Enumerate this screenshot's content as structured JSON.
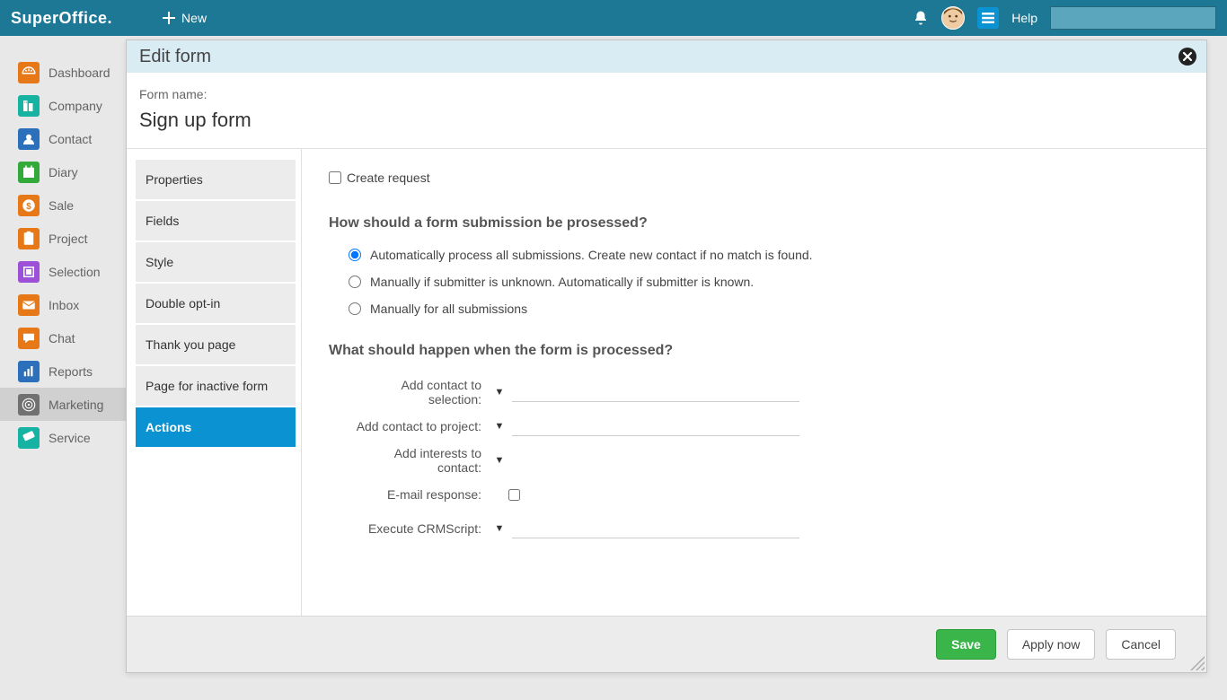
{
  "topbar": {
    "logo": "SuperOffice",
    "new_label": "New",
    "help_label": "Help"
  },
  "sidebar": {
    "items": [
      {
        "label": "Dashboard",
        "bg": "bg-orange"
      },
      {
        "label": "Company",
        "bg": "bg-teal"
      },
      {
        "label": "Contact",
        "bg": "bg-blue"
      },
      {
        "label": "Diary",
        "bg": "bg-green"
      },
      {
        "label": "Sale",
        "bg": "bg-orange"
      },
      {
        "label": "Project",
        "bg": "bg-orange"
      },
      {
        "label": "Selection",
        "bg": "bg-purple"
      },
      {
        "label": "Inbox",
        "bg": "bg-orange"
      },
      {
        "label": "Chat",
        "bg": "bg-orange"
      },
      {
        "label": "Reports",
        "bg": "bg-blue"
      },
      {
        "label": "Marketing",
        "bg": "bg-target",
        "active": true
      },
      {
        "label": "Service",
        "bg": "bg-teal"
      }
    ]
  },
  "modal": {
    "title": "Edit form",
    "form_name_label": "Form name:",
    "form_name_value": "Sign up form",
    "tabs": [
      {
        "label": "Properties"
      },
      {
        "label": "Fields"
      },
      {
        "label": "Style"
      },
      {
        "label": "Double opt-in"
      },
      {
        "label": "Thank you page"
      },
      {
        "label": "Page for inactive form"
      },
      {
        "label": "Actions",
        "active": true
      }
    ],
    "content": {
      "create_request": "Create request",
      "q1_title": "How should a form submission be prosessed?",
      "q1_options": [
        "Automatically process all submissions. Create new contact if no match is found.",
        "Manually if submitter is unknown. Automatically if submitter is known.",
        "Manually for all submissions"
      ],
      "q2_title": "What should happen when the form is processed?",
      "fields": [
        {
          "label": "Add contact to selection:",
          "type": "dropdown"
        },
        {
          "label": "Add contact to project:",
          "type": "dropdown"
        },
        {
          "label": "Add interests to contact:",
          "type": "dropdown-only"
        },
        {
          "label": "E-mail response:",
          "type": "checkbox"
        },
        {
          "label": "Execute CRMScript:",
          "type": "dropdown"
        }
      ]
    },
    "footer": {
      "save": "Save",
      "apply": "Apply now",
      "cancel": "Cancel"
    }
  }
}
